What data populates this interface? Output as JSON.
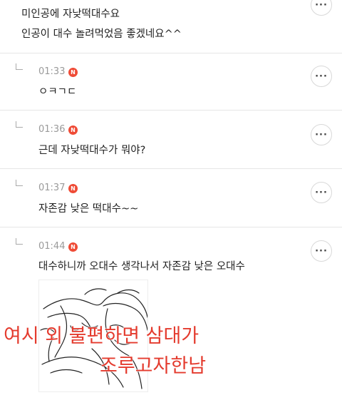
{
  "main_comment": {
    "line1": "미인공에 자낮떡대수요",
    "line2": "인공이 대수 놀려먹었음 좋겠네요^^"
  },
  "more_label": "···",
  "badge_letter": "N",
  "replies": [
    {
      "time": "01:33",
      "text": "ㅇㅋㄱㄷ"
    },
    {
      "time": "01:36",
      "text": "근데 자낮떡대수가 뭐야?"
    },
    {
      "time": "01:37",
      "text": "자존감 낮은 떡대수~~"
    },
    {
      "time": "01:44",
      "text": "대수하니까 오대수 생각나서 자존감 낮은 오대수"
    }
  ],
  "image_caption": {
    "line1": "여시 외 불편하면 삼대가",
    "line2": "조루고자한남"
  },
  "colors": {
    "badge": "#ef4b36",
    "overlay_text": "#e43b2e",
    "divider": "#e6e6e6"
  }
}
